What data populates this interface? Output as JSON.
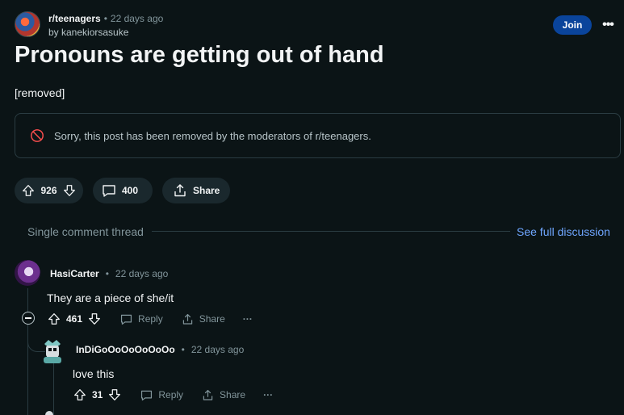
{
  "post": {
    "subreddit": "r/teenagers",
    "age": "22 days ago",
    "by_line": "by kanekiorsasuke",
    "join_label": "Join",
    "more_label": "•••",
    "title": "Pronouns are getting out of hand",
    "body": "[removed]",
    "removed_notice": "Sorry, this post has been removed by the moderators of r/teenagers.",
    "votes": "926",
    "comments": "400",
    "share_label": "Share"
  },
  "thread": {
    "label": "Single comment thread",
    "link": "See full discussion"
  },
  "comments": [
    {
      "author": "HasiCarter",
      "age": "22 days ago",
      "body": "They are a piece of she/it",
      "votes": "461",
      "reply_label": "Reply",
      "share_label": "Share",
      "more_label": "···"
    },
    {
      "author": "InDiGoOoOoOoOoOo",
      "age": "22 days ago",
      "body": "love this",
      "votes": "31",
      "reply_label": "Reply",
      "share_label": "Share",
      "more_label": "···"
    }
  ],
  "colors": {
    "background": "#0b1416",
    "join_button": "#0a449b",
    "link": "#6fa6ff",
    "pill": "#1a282d"
  },
  "icons": [
    "upvote-icon",
    "downvote-icon",
    "comment-icon",
    "share-icon",
    "ban-icon",
    "collapse-icon",
    "more-icon"
  ]
}
